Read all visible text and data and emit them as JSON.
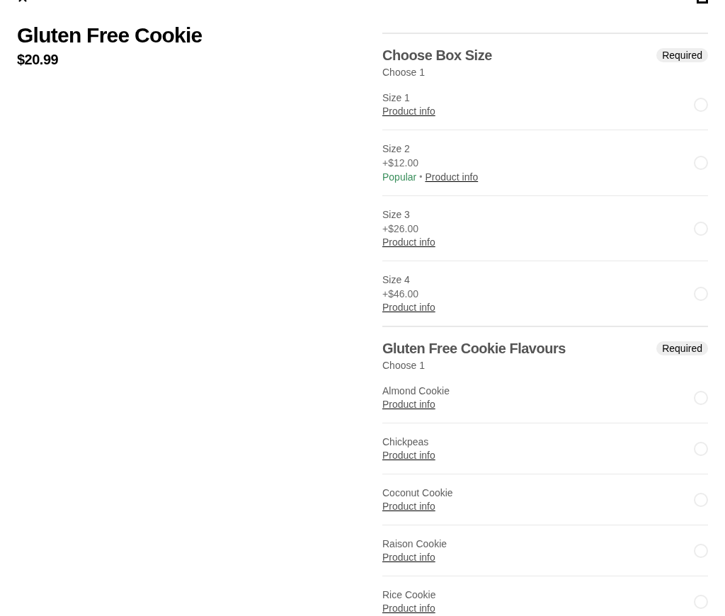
{
  "product": {
    "title": "Gluten Free Cookie",
    "price": "$20.99"
  },
  "option_groups": [
    {
      "title": "Choose Box Size",
      "badge": "Required",
      "hint": "Choose 1",
      "options": [
        {
          "name": "Size 1",
          "link": "Product info",
          "selected": false
        },
        {
          "name": "Size 2",
          "price": "+$12.00",
          "tag": "Popular",
          "separator": "•",
          "link": "Product info",
          "selected": false
        },
        {
          "name": "Size 3",
          "price": "+$26.00",
          "link": "Product info",
          "selected": false
        },
        {
          "name": "Size 4",
          "price": "+$46.00",
          "link": "Product info",
          "selected": false
        }
      ]
    },
    {
      "title": "Gluten Free Cookie Flavours",
      "badge": "Required",
      "hint": "Choose 1",
      "options": [
        {
          "name": "Almond Cookie",
          "link": "Product info",
          "selected": false
        },
        {
          "name": "Chickpeas",
          "link": "Product info",
          "selected": false
        },
        {
          "name": "Coconut Cookie",
          "link": "Product info",
          "selected": false
        },
        {
          "name": "Raison Cookie",
          "link": "Product info",
          "selected": false
        },
        {
          "name": "Rice Cookie",
          "link": "Product info",
          "selected": false
        }
      ]
    }
  ]
}
